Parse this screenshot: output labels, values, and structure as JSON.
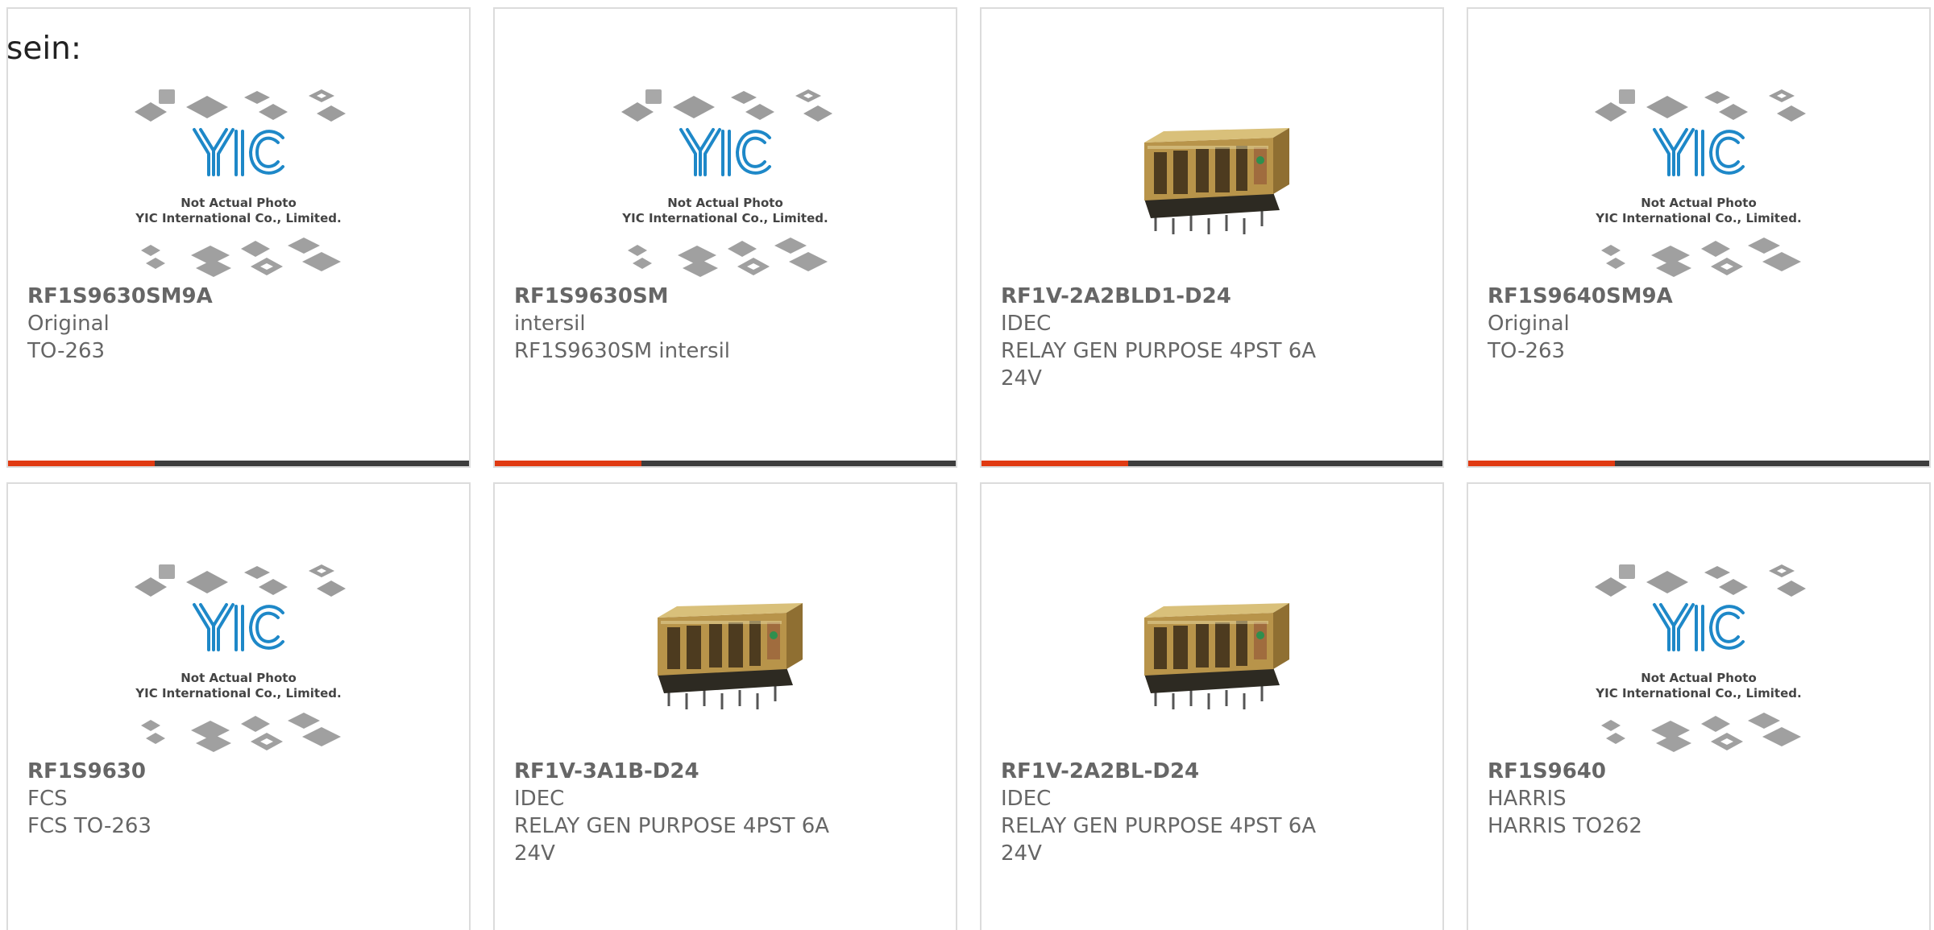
{
  "leading_text": "sein:",
  "placeholder_image": {
    "line1": "Not Actual Photo",
    "line2": "YIC International Co., Limited.",
    "logo": "YIC"
  },
  "colors": {
    "accent": "#e03a12",
    "bar": "#3d3d3d",
    "logo_blue": "#1e88c8",
    "text": "#666666"
  },
  "products": [
    {
      "part_number": "RF1S9630SM9A",
      "manufacturer": "Original",
      "description": "TO-263",
      "image": "yic-placeholder"
    },
    {
      "part_number": "RF1S9630SM",
      "manufacturer": "intersil",
      "description": "RF1S9630SM intersil",
      "image": "yic-placeholder"
    },
    {
      "part_number": "RF1V-2A2BLD1-D24",
      "manufacturer": "IDEC",
      "description": "RELAY GEN PURPOSE 4PST 6A 24V",
      "image": "relay-photo"
    },
    {
      "part_number": "RF1S9640SM9A",
      "manufacturer": "Original",
      "description": "TO-263",
      "image": "yic-placeholder"
    },
    {
      "part_number": "RF1S9630",
      "manufacturer": "FCS",
      "description": "FCS TO-263",
      "image": "yic-placeholder"
    },
    {
      "part_number": "RF1V-3A1B-D24",
      "manufacturer": "IDEC",
      "description": "RELAY GEN PURPOSE 4PST 6A 24V",
      "image": "relay-photo"
    },
    {
      "part_number": "RF1V-2A2BL-D24",
      "manufacturer": "IDEC",
      "description": "RELAY GEN PURPOSE 4PST 6A 24V",
      "image": "relay-photo"
    },
    {
      "part_number": "RF1S9640",
      "manufacturer": "HARRIS",
      "description": "HARRIS TO262",
      "image": "yic-placeholder"
    }
  ]
}
